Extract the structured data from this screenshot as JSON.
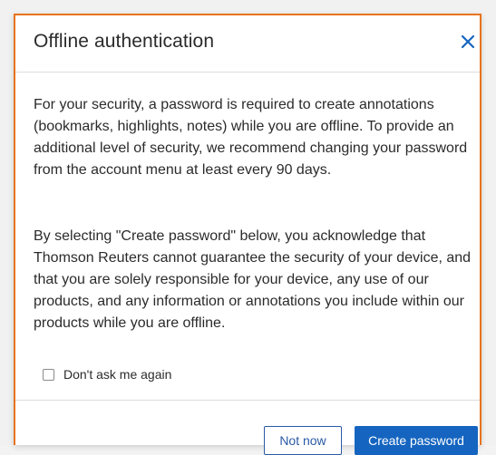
{
  "dialog": {
    "title": "Offline authentication",
    "close_icon": "close-icon",
    "paragraph_1": "For your security, a password is required to create annotations (bookmarks, highlights, notes) while you are offline. To provide an additional level of security, we recommend changing your password from the account menu at least every 90 days.",
    "paragraph_2": "By selecting \"Create password\" below, you acknowledge that Thomson Reuters cannot guarantee the security of your device, and that you are solely responsible for your device, any use of our products, and any information or annotations you include within our products while you are offline.",
    "checkbox": {
      "label": "Don't ask me again",
      "checked": false
    },
    "buttons": {
      "secondary_label": "Not now",
      "primary_label": "Create password"
    }
  },
  "colors": {
    "focus_border": "#e8731c",
    "primary_button": "#1565c0",
    "close_icon": "#1565c0"
  }
}
